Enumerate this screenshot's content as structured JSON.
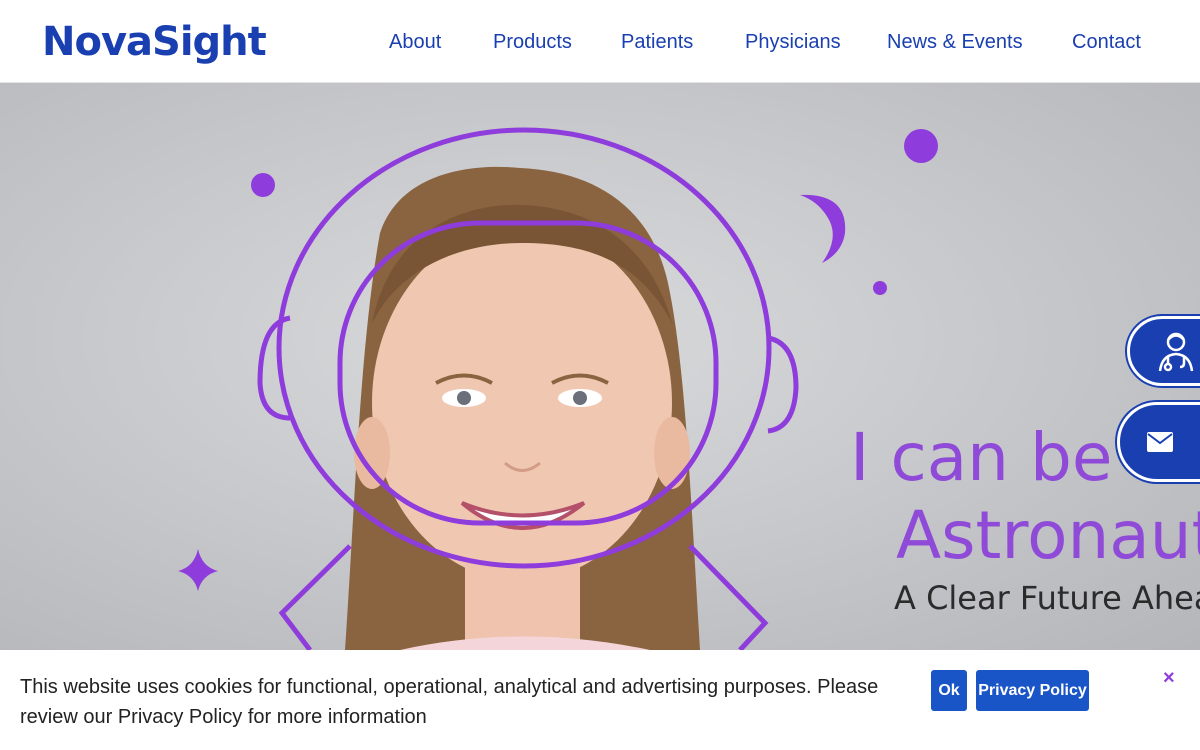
{
  "brand": {
    "logo_text": "NovaSight",
    "color": "#1a3fb0",
    "accent": "#8f3cdc"
  },
  "nav": {
    "items": [
      {
        "label": "About"
      },
      {
        "label": "Products"
      },
      {
        "label": "Patients"
      },
      {
        "label": "Physicians"
      },
      {
        "label": "News & Events"
      },
      {
        "label": "Contact"
      }
    ]
  },
  "hero": {
    "headline_line1": "I can be a",
    "headline_line2": "Astronaut",
    "tagline": "A Clear Future Ahea",
    "accent_color": "#8f4bd8"
  },
  "side_buttons": [
    {
      "icon": "doctor-icon"
    },
    {
      "icon": "envelope-icon"
    }
  ],
  "cookie_banner": {
    "text": "This website uses cookies for functional, operational, analytical and advertising purposes. Please review our Privacy Policy for more information",
    "ok_label": "Ok",
    "privacy_label": "Privacy Policy",
    "close_label": "×"
  }
}
